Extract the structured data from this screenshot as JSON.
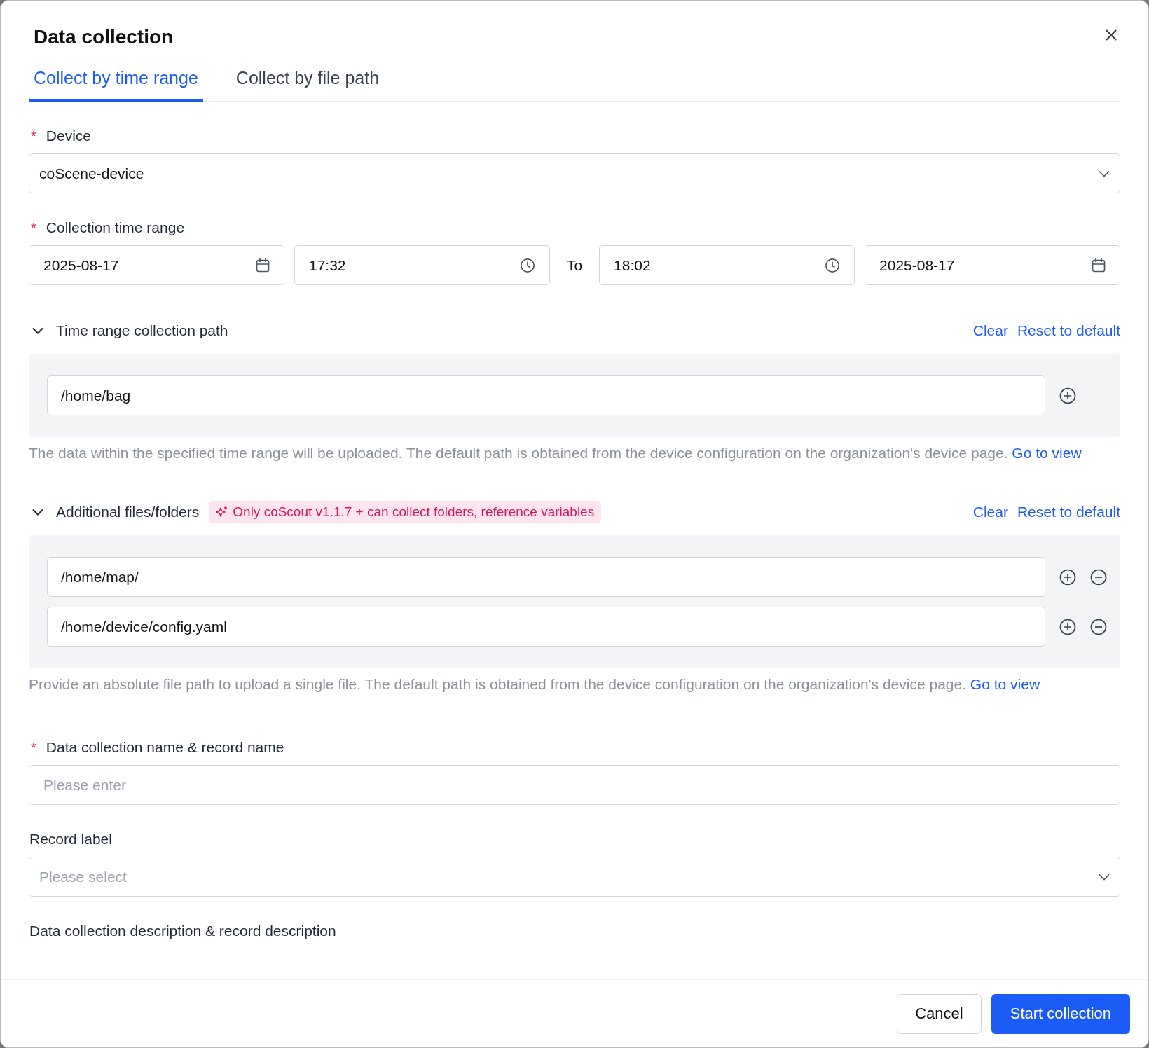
{
  "dialog": {
    "title": "Data collection"
  },
  "tabs": [
    {
      "label": "Collect by time range",
      "selected": true
    },
    {
      "label": "Collect by file path",
      "selected": false
    }
  ],
  "device": {
    "required_mark": "*",
    "label": "Device",
    "value": "coScene-device"
  },
  "time_range": {
    "required_mark": "*",
    "label": "Collection time range",
    "items": [
      {
        "kind": "date",
        "value": "2025-08-17"
      },
      {
        "kind": "time",
        "value": "17:32"
      },
      {
        "kind": "separator",
        "value": "To"
      },
      {
        "kind": "time",
        "value": "18:02"
      },
      {
        "kind": "date",
        "value": "2025-08-17"
      }
    ]
  },
  "sections": [
    {
      "title": "Time range collection path",
      "expanded": true,
      "actions": [
        "Clear",
        "Reset to default"
      ],
      "paths": [
        {
          "value": "/home/bag",
          "removable": false
        }
      ],
      "help": "The data within the specified time range will be uploaded. The default path is obtained from the device configuration on the organization's device page.",
      "help_link": "Go to view"
    },
    {
      "title": "Additional files/folders",
      "expanded": true,
      "badge": "Only coScout v1.1.7 + can collect folders, reference variables",
      "actions": [
        "Clear",
        "Reset to default"
      ],
      "paths": [
        {
          "value": "/home/map/",
          "removable": true
        },
        {
          "value": "/home/device/config.yaml",
          "removable": true
        }
      ],
      "help": "Provide an absolute file path to upload a single file. The default path is obtained from the device configuration on the organization's device page.",
      "help_link": "Go to view"
    }
  ],
  "name_field": {
    "required_mark": "*",
    "label": "Data collection name & record name",
    "placeholder": "Please enter"
  },
  "record_label": {
    "label": "Record label",
    "placeholder": "Please select"
  },
  "description": {
    "label": "Data collection description & record description"
  },
  "buttons": [
    {
      "label": "Cancel",
      "kind": "secondary"
    },
    {
      "label": "Start collection",
      "kind": "primary"
    }
  ]
}
